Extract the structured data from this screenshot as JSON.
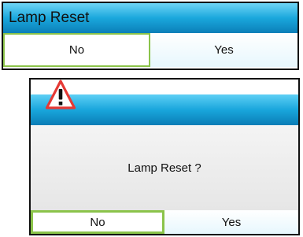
{
  "reset_panel": {
    "title": "Lamp Reset",
    "no_label": "No",
    "yes_label": "Yes"
  },
  "confirm_dialog": {
    "icon": "warning-icon",
    "message": "Lamp Reset ?",
    "no_label": "No",
    "yes_label": "Yes"
  },
  "colors": {
    "title_bar": "#19a6dc",
    "selection_border": "#8bc34a",
    "warning": "#e53935"
  }
}
